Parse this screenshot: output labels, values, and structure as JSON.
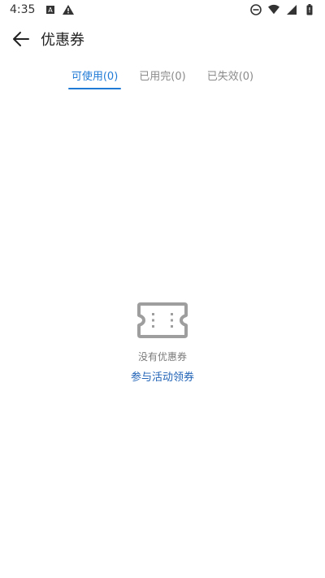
{
  "status_bar": {
    "time": "4:35",
    "left_icons": [
      "a-box-icon",
      "warning-icon"
    ],
    "right_icons": [
      "do-not-disturb-icon",
      "wifi-icon",
      "signal-icon",
      "battery-icon"
    ]
  },
  "header": {
    "title": "优惠券",
    "back_icon": "arrow-left-icon"
  },
  "tabs": [
    {
      "label": "可使用(0)",
      "active": true
    },
    {
      "label": "已用完(0)",
      "active": false
    },
    {
      "label": "已失效(0)",
      "active": false
    }
  ],
  "empty_state": {
    "icon": "ticket-icon",
    "message": "没有优惠券",
    "action_label": "参与活动领券"
  },
  "colors": {
    "accent": "#1f7ad6",
    "link": "#1f62b6",
    "muted_text": "#8a8a8a",
    "icon_gray": "#9e9e9e"
  }
}
